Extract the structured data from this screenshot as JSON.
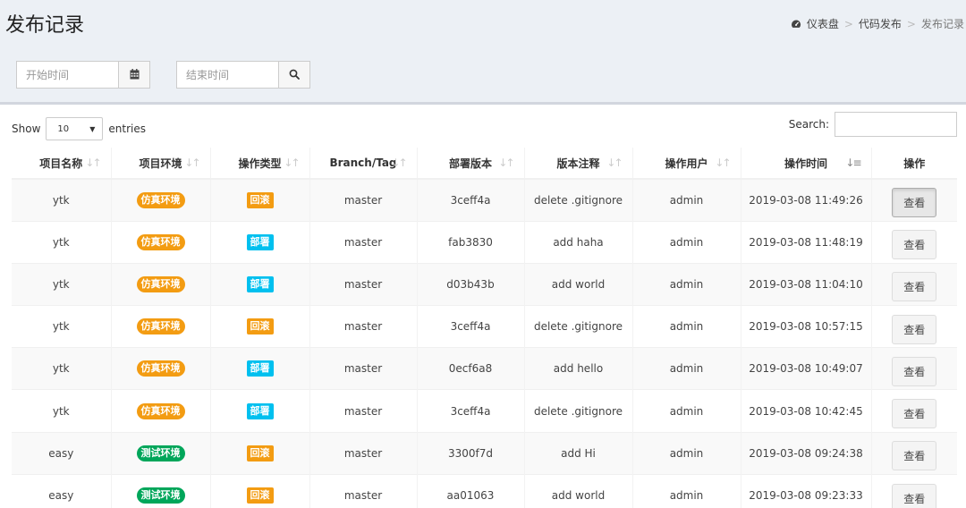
{
  "page": {
    "title": "发布记录"
  },
  "breadcrumb": {
    "home": "仪表盘",
    "parent": "代码发布",
    "current": "发布记录",
    "sep": ">"
  },
  "filters": {
    "start_placeholder": "开始时间",
    "end_placeholder": "结束时间"
  },
  "table_controls": {
    "show_label": "Show",
    "length_value": "10",
    "entries_label": "entries",
    "search_label": "Search:"
  },
  "columns": [
    "项目名称",
    "项目环境",
    "操作类型",
    "Branch/Tag",
    "部署版本",
    "版本注释",
    "操作用户",
    "操作时间",
    "操作"
  ],
  "rows": [
    {
      "project": "ytk",
      "env": "仿真环境",
      "env_color": "orange",
      "op": "回滚",
      "op_color": "orange",
      "branch": "master",
      "version": "3ceff4a",
      "note": "delete .gitignore",
      "user": "admin",
      "time": "2019-03-08 11:49:26",
      "action": "查看"
    },
    {
      "project": "ytk",
      "env": "仿真环境",
      "env_color": "orange",
      "op": "部署",
      "op_color": "blue",
      "branch": "master",
      "version": "fab3830",
      "note": "add haha",
      "user": "admin",
      "time": "2019-03-08 11:48:19",
      "action": "查看"
    },
    {
      "project": "ytk",
      "env": "仿真环境",
      "env_color": "orange",
      "op": "部署",
      "op_color": "blue",
      "branch": "master",
      "version": "d03b43b",
      "note": "add world",
      "user": "admin",
      "time": "2019-03-08 11:04:10",
      "action": "查看"
    },
    {
      "project": "ytk",
      "env": "仿真环境",
      "env_color": "orange",
      "op": "回滚",
      "op_color": "orange",
      "branch": "master",
      "version": "3ceff4a",
      "note": "delete .gitignore",
      "user": "admin",
      "time": "2019-03-08 10:57:15",
      "action": "查看"
    },
    {
      "project": "ytk",
      "env": "仿真环境",
      "env_color": "orange",
      "op": "部署",
      "op_color": "blue",
      "branch": "master",
      "version": "0ecf6a8",
      "note": "add hello",
      "user": "admin",
      "time": "2019-03-08 10:49:07",
      "action": "查看"
    },
    {
      "project": "ytk",
      "env": "仿真环境",
      "env_color": "orange",
      "op": "部署",
      "op_color": "blue",
      "branch": "master",
      "version": "3ceff4a",
      "note": "delete .gitignore",
      "user": "admin",
      "time": "2019-03-08 10:42:45",
      "action": "查看"
    },
    {
      "project": "easy",
      "env": "测试环境",
      "env_color": "green",
      "op": "回滚",
      "op_color": "orange",
      "branch": "master",
      "version": "3300f7d",
      "note": "add Hi",
      "user": "admin",
      "time": "2019-03-08 09:24:38",
      "action": "查看"
    },
    {
      "project": "easy",
      "env": "测试环境",
      "env_color": "green",
      "op": "回滚",
      "op_color": "orange",
      "branch": "master",
      "version": "aa01063",
      "note": "add world",
      "user": "admin",
      "time": "2019-03-08 09:23:33",
      "action": "查看"
    }
  ],
  "icons": {
    "home": "dashboard-icon",
    "calendar": "calendar-icon",
    "search": "search-icon",
    "sort": "sort-icon",
    "dropdown": "caret-down-icon"
  },
  "colors": {
    "orange": "#f39c12",
    "blue": "#00c0ef",
    "green": "#00a65a"
  }
}
